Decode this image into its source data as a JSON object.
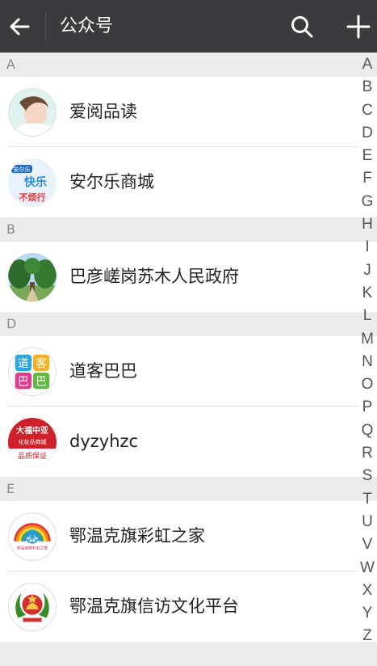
{
  "header": {
    "title": "公众号",
    "back_icon": "arrow-left-icon",
    "search_icon": "search-icon",
    "add_icon": "plus-icon"
  },
  "sections": [
    {
      "letter": "A",
      "items": [
        {
          "name": "爱阅品读",
          "avatar": "woman-photo-avatar"
        },
        {
          "name": "安尔乐商城",
          "avatar": "anerle-logo-avatar"
        }
      ]
    },
    {
      "letter": "B",
      "items": [
        {
          "name": "巴彦嵯岗苏木人民政府",
          "avatar": "trees-photo-avatar"
        }
      ]
    },
    {
      "letter": "D",
      "items": [
        {
          "name": "道客巴巴",
          "avatar": "daoke-logo-avatar"
        },
        {
          "name": "dyzyhzc",
          "avatar": "dazhongya-logo-avatar"
        }
      ]
    },
    {
      "letter": "E",
      "items": [
        {
          "name": "鄂温克旗彩虹之家",
          "avatar": "rainbow-logo-avatar"
        },
        {
          "name": "鄂温克旗信访文化平台",
          "avatar": "emblem-avatar"
        }
      ]
    }
  ],
  "avatar_texts": {
    "anerle_top": "安尔乐",
    "anerle_mid": "快乐",
    "anerle_bottom": "不烦行",
    "daoke": [
      "道",
      "客",
      "巴",
      "巴"
    ],
    "dazhongya_top": "大福中亚",
    "dazhongya_mid": "化妆品商城",
    "dazhongya_bottom": "品质保证",
    "rainbow_caption": "鄂温克旗彩虹之家"
  },
  "index_letters": [
    "A",
    "B",
    "C",
    "D",
    "E",
    "F",
    "G",
    "H",
    "I",
    "J",
    "K",
    "L",
    "M",
    "N",
    "O",
    "P",
    "Q",
    "R",
    "S",
    "T",
    "U",
    "V",
    "W",
    "X",
    "Y",
    "Z"
  ],
  "colors": {
    "header_bg": "#3a3b3f",
    "section_bg": "#ececec",
    "text": "#222222"
  }
}
